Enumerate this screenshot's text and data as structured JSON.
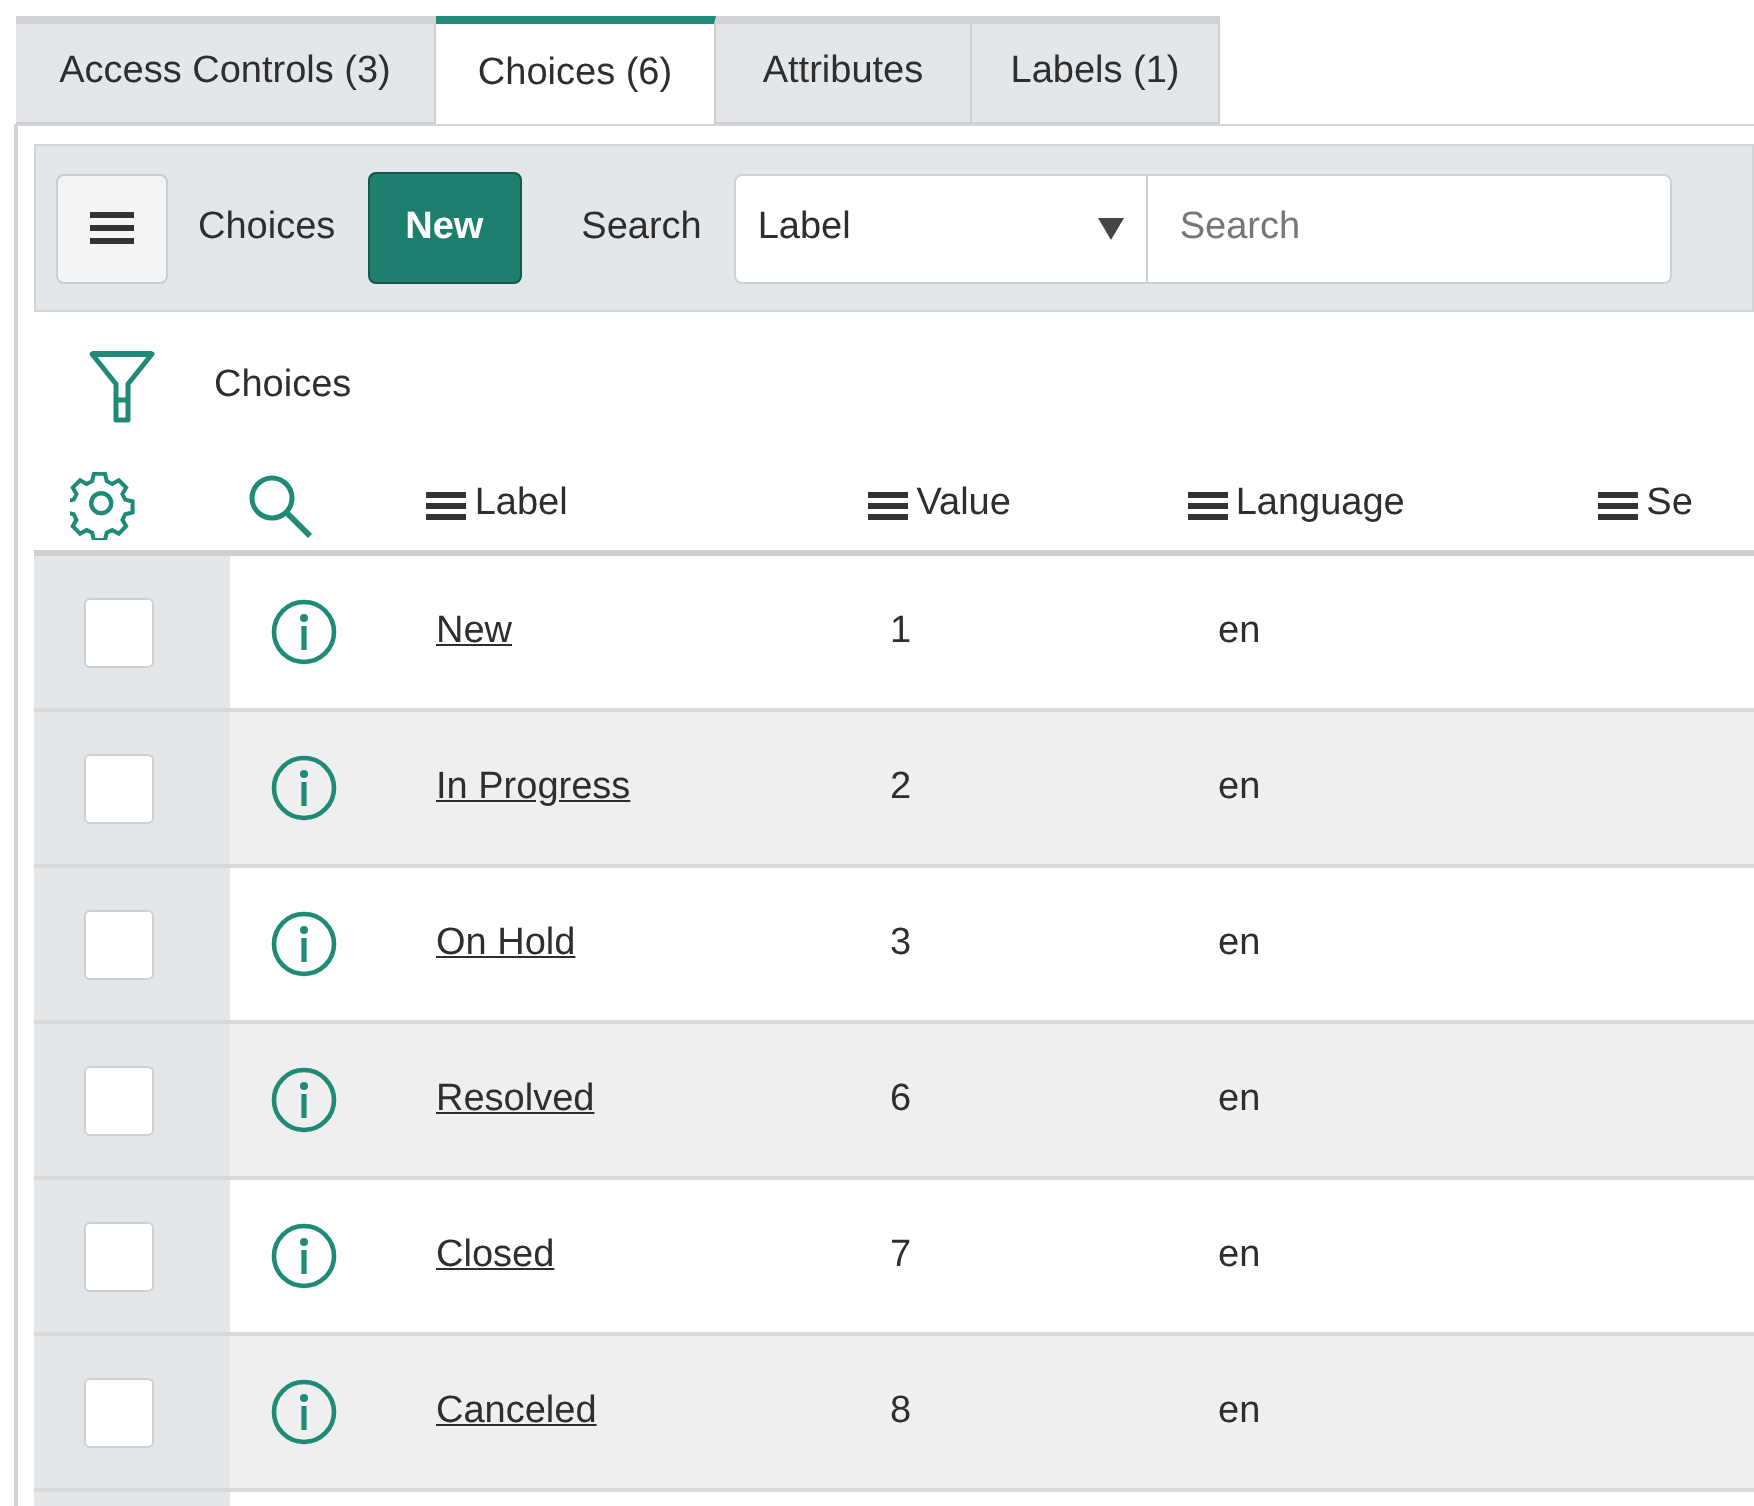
{
  "tabs": [
    {
      "label": "Access Controls (3)",
      "selected": false
    },
    {
      "label": "Choices (6)",
      "selected": true
    },
    {
      "label": "Attributes",
      "selected": false
    },
    {
      "label": "Labels (1)",
      "selected": false
    }
  ],
  "toolbar": {
    "title": "Choices",
    "new_button": "New",
    "search_label": "Search",
    "search_field": {
      "value": "Label"
    },
    "search_input": {
      "placeholder": "Search"
    }
  },
  "filter": {
    "label": "Choices"
  },
  "table": {
    "columns": [
      "Label",
      "Value",
      "Language",
      "Se"
    ],
    "rows": [
      {
        "label": "New",
        "value": "1",
        "language": "en",
        "checked": false
      },
      {
        "label": "In Progress",
        "value": "2",
        "language": "en",
        "checked": false
      },
      {
        "label": "On Hold",
        "value": "3",
        "language": "en",
        "checked": false
      },
      {
        "label": "Resolved",
        "value": "6",
        "language": "en",
        "checked": false
      },
      {
        "label": "Closed",
        "value": "7",
        "language": "en",
        "checked": false
      },
      {
        "label": "Canceled",
        "value": "8",
        "language": "en",
        "checked": false
      }
    ]
  }
}
